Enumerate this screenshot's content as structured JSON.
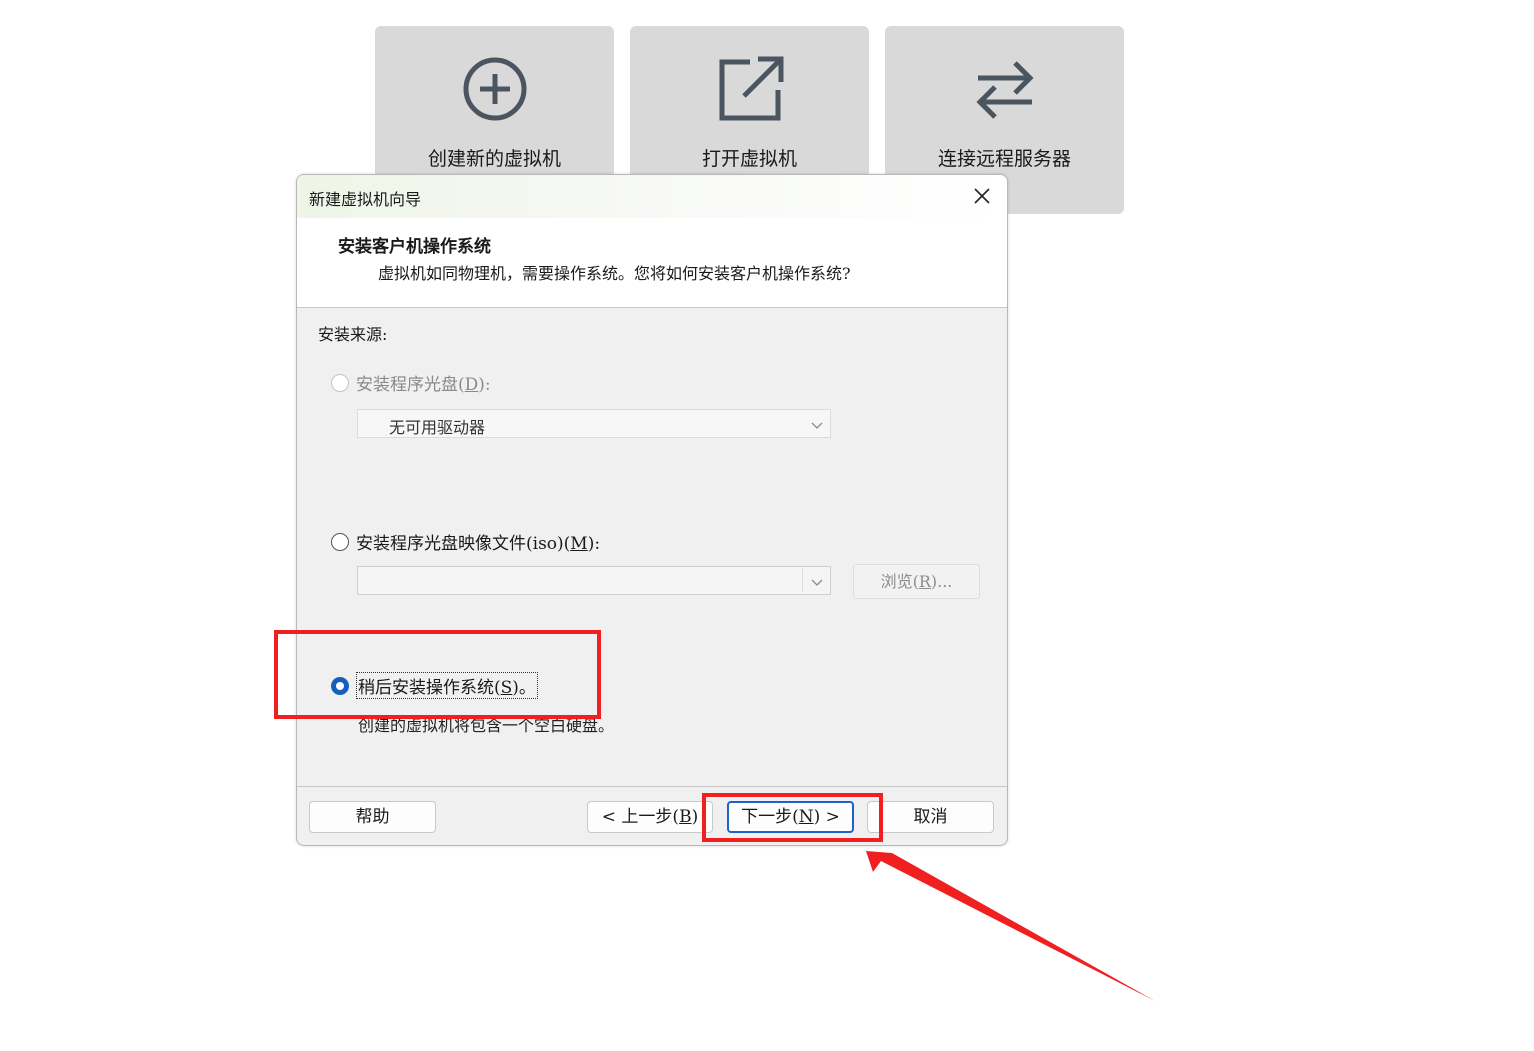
{
  "tiles": {
    "create": "创建新的虚拟机",
    "open": "打开虚拟机",
    "connect": "连接远程服务器"
  },
  "dialog": {
    "title": "新建虚拟机向导",
    "heading": "安装客户机操作系统",
    "subheading": "虚拟机如同物理机，需要操作系统。您将如何安装客户机操作系统?",
    "source_label": "安装来源:",
    "option_disc": {
      "label": "安装程序光盘(",
      "key": "D",
      "tail": "):",
      "enabled": false
    },
    "disc_combo_value": "无可用驱动器",
    "option_iso": {
      "label": "安装程序光盘映像文件(iso)(",
      "key": "M",
      "tail": "):"
    },
    "iso_combo_value": "",
    "browse": {
      "label": "浏览(",
      "key": "R",
      "tail": ")..."
    },
    "option_later": {
      "label": "稍后安装操作系统(",
      "key": "S",
      "tail": ")。",
      "checked": true
    },
    "later_note": "创建的虚拟机将包含一个空白硬盘。",
    "buttons": {
      "help": "帮助",
      "back_label": "< 上一步(",
      "back_key": "B",
      "back_tail": ")",
      "next_label": "下一步(",
      "next_key": "N",
      "next_tail": ") >",
      "cancel": "取消"
    }
  },
  "colors": {
    "annotation_red": "#f02020",
    "radio_checked": "#1560bd",
    "tile_bg": "#d9d9d9"
  },
  "icons": [
    "plus-circle-icon",
    "open-external-icon",
    "swap-arrows-icon",
    "close-icon",
    "chevron-down-icon"
  ]
}
